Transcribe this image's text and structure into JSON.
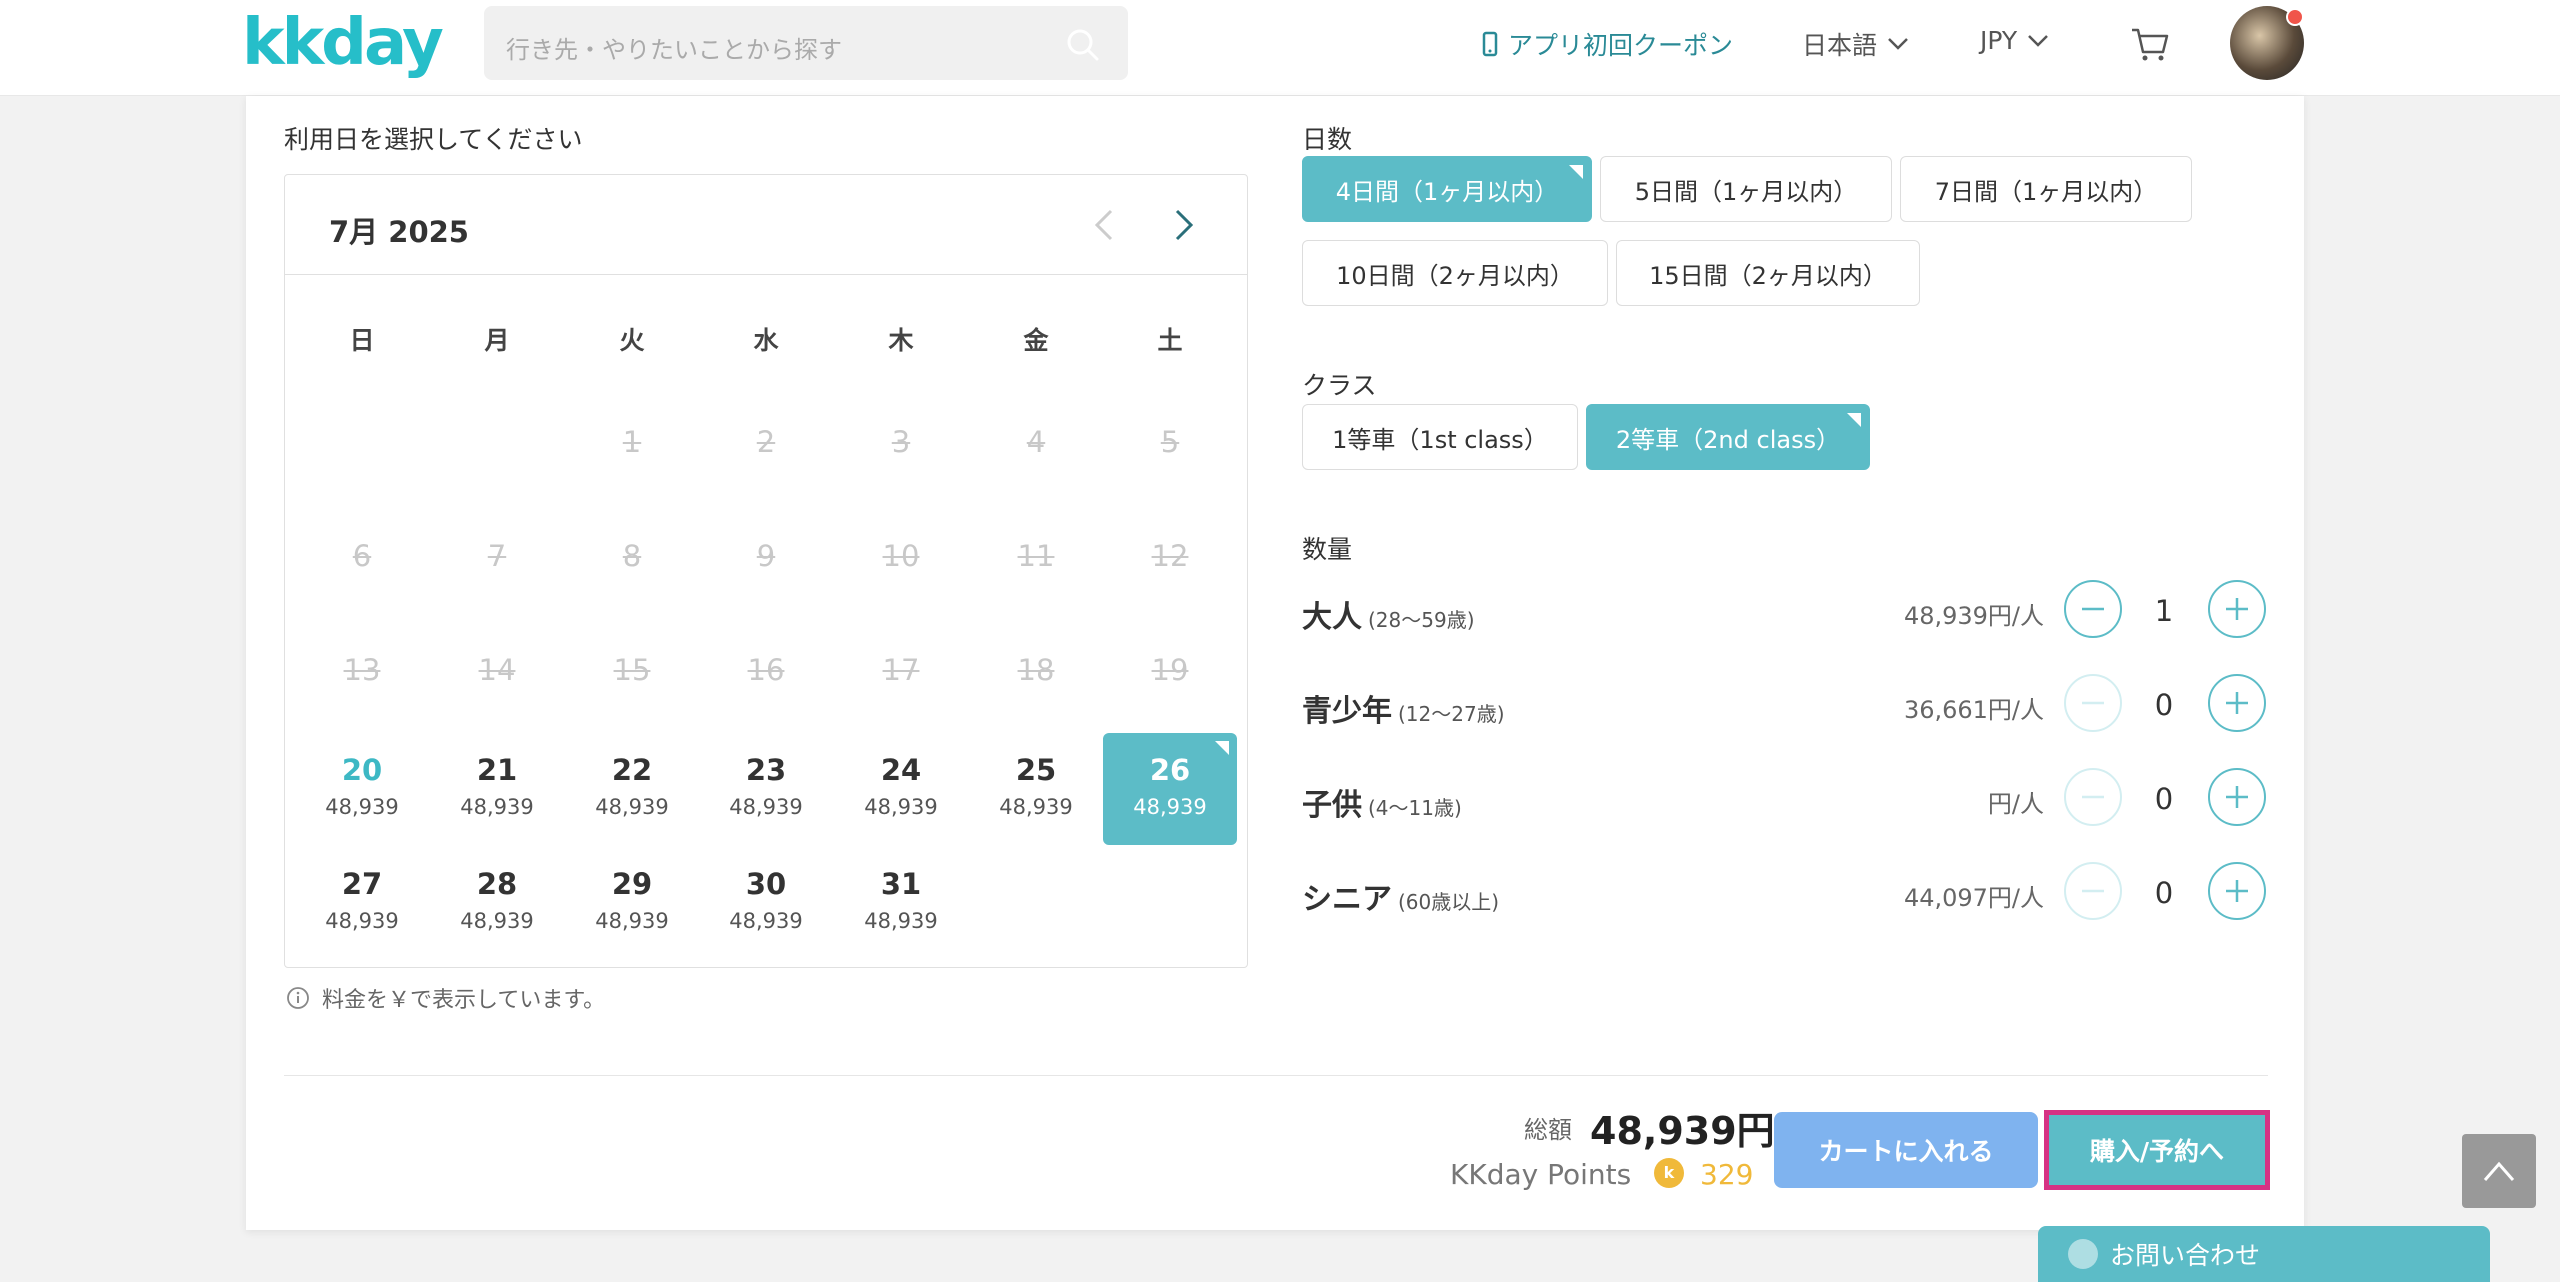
{
  "header": {
    "logo": "kkday",
    "search_placeholder": "行き先・やりたいことから探す",
    "coupon": "アプリ初回クーポン",
    "language": "日本語",
    "currency": "JPY"
  },
  "calendar": {
    "section_title": "利用日を選択してください",
    "month": "7月 2025",
    "weekdays": [
      "日",
      "月",
      "火",
      "水",
      "木",
      "金",
      "土"
    ],
    "disabled_days": [
      "1",
      "2",
      "3",
      "4",
      "5",
      "6",
      "7",
      "8",
      "9",
      "10",
      "11",
      "12",
      "13",
      "14",
      "15",
      "16",
      "17",
      "18",
      "19"
    ],
    "available_days": [
      {
        "day": "20",
        "price": "48,939"
      },
      {
        "day": "21",
        "price": "48,939"
      },
      {
        "day": "22",
        "price": "48,939"
      },
      {
        "day": "23",
        "price": "48,939"
      },
      {
        "day": "24",
        "price": "48,939"
      },
      {
        "day": "25",
        "price": "48,939"
      },
      {
        "day": "26",
        "price": "48,939"
      },
      {
        "day": "27",
        "price": "48,939"
      },
      {
        "day": "28",
        "price": "48,939"
      },
      {
        "day": "29",
        "price": "48,939"
      },
      {
        "day": "30",
        "price": "48,939"
      },
      {
        "day": "31",
        "price": "48,939"
      }
    ],
    "note": "料金を￥で表示しています。"
  },
  "days_option": {
    "title": "日数",
    "options": [
      "4日間（1ヶ月以内）",
      "5日間（1ヶ月以内）",
      "7日間（1ヶ月以内）",
      "10日間（2ヶ月以内）",
      "15日間（2ヶ月以内）"
    ],
    "selected": 0
  },
  "class_option": {
    "title": "クラス",
    "options": [
      "1等車（1st class）",
      "2等車（2nd class）"
    ],
    "selected": 1
  },
  "quantity": {
    "title": "数量",
    "rows": [
      {
        "label": "大人",
        "age": "(28〜59歳)",
        "price": "48,939円/人",
        "value": "1"
      },
      {
        "label": "青少年",
        "age": "(12〜27歳)",
        "price": "36,661円/人",
        "value": "0"
      },
      {
        "label": "子供",
        "age": "(4〜11歳)",
        "price": "円/人",
        "value": "0"
      },
      {
        "label": "シニア",
        "age": "(60歳以上)",
        "price": "44,097円/人",
        "value": "0"
      }
    ]
  },
  "footer": {
    "total_label": "総額",
    "total_value": "48,939円",
    "points_label": "KKday Points",
    "points_icon": "k",
    "points_value": "329",
    "cart_button": "カートに入れる",
    "buy_button": "購入/予約へ",
    "contact": "お問い合わせ"
  },
  "colors": {
    "accent": "#5cbcc7",
    "cart_button": "#7fb3ef",
    "highlight_border": "#d63384",
    "points": "#f0b93a"
  }
}
